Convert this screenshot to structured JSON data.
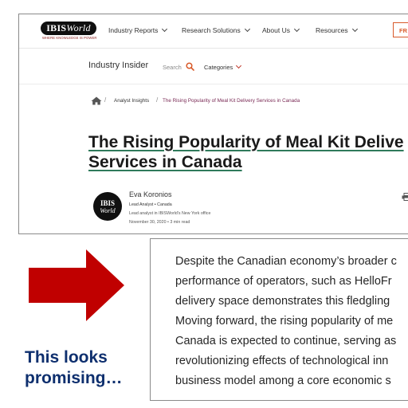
{
  "screenshot": {
    "logo": {
      "brand_bold": "IBIS",
      "brand_italic": "World",
      "tagline": "WHERE KNOWLEDGE IS POWER"
    },
    "nav": {
      "items": [
        "Industry Reports",
        "Research Solutions",
        "About Us",
        "Resources"
      ],
      "button_label": "FR"
    },
    "subnav": {
      "title": "Industry Insider",
      "search_placeholder": "Search",
      "categories_label": "Categories"
    },
    "breadcrumb": {
      "section": "Analyst Insights",
      "current": "The Rising Popularity of Meal Kit Delivery Services in Canada"
    },
    "headline": {
      "line1": "The Rising Popularity of Meal Kit Delive",
      "line2": "Services in Canada"
    },
    "author": {
      "avatar_line1": "IBIS",
      "avatar_line2": "World",
      "name": "Eva Koronios",
      "role": "Lead Analyst • Canada",
      "description": "Lead analyst in IBISWorld's New York office",
      "date": "November 30, 2020 • 3 min read"
    }
  },
  "caption": {
    "line1": "This looks",
    "line2": "promising…"
  },
  "excerpt": {
    "lines": [
      "Despite the Canadian economy’s broader c",
      "performance of operators, such as HelloFr",
      "delivery space demonstrates this fledgling",
      "Moving forward, the rising popularity of me",
      "Canada is expected to continue, serving as",
      "revolutionizing effects of technological inn",
      "business model among a core economic s"
    ]
  },
  "colors": {
    "arrow": "#c00000",
    "caption": "#0e2f6e",
    "accent": "#d85a2a",
    "underline": "#2f7a5b"
  },
  "icons": [
    "home-icon",
    "search-icon",
    "chevron-down-icon",
    "print-icon",
    "right-arrow-icon"
  ]
}
